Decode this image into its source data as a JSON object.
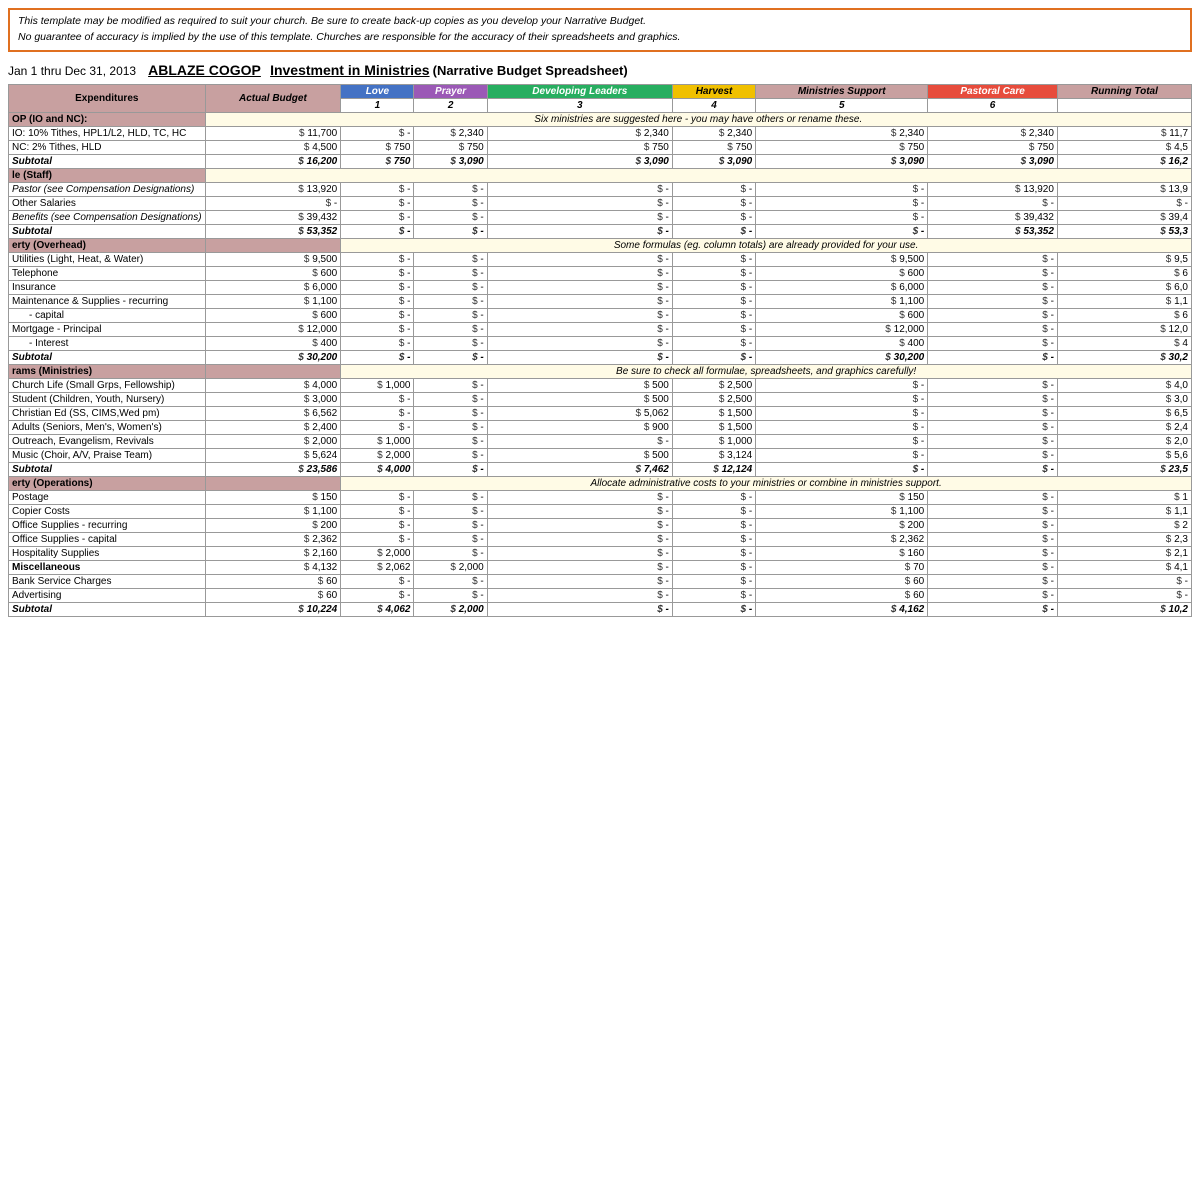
{
  "disclaimer": {
    "line1": "This template may be modified as required to suit your church.  Be sure to create back-up copies as you develop your Narrative Budget.",
    "line2": "No guarantee of accuracy is implied by the use of this template.  Churches are responsible for the accuracy of their spreadsheets and graphics."
  },
  "header": {
    "date_range": "Jan 1 thru Dec 31, 2013",
    "org_name": "ABLAZE COGOP",
    "title_part1": "Investment in Ministries",
    "title_part2": "(Narrative Budget Spreadsheet)"
  },
  "columns": {
    "expenditures": "Expenditures",
    "actual_budget": "Actual Budget",
    "love": "Love",
    "love_num": "1",
    "prayer": "Prayer",
    "prayer_num": "2",
    "developing": "Developing Leaders",
    "developing_num": "3",
    "harvest": "Harvest",
    "harvest_num": "4",
    "ministries_support": "Ministries Support",
    "ministries_num": "5",
    "pastoral_care": "Pastoral Care",
    "pastoral_num": "6",
    "running_total": "Running Total"
  },
  "notes": {
    "op_note": "Six ministries are suggested here - you may have others or rename these.",
    "property_note": "Some formulas (eg. column totals) are already provided for your use.",
    "programs_note": "Be sure to check all formulae, spreadsheets, and graphics carefully!",
    "admin_note": "Allocate administrative costs to your ministries or combine in ministries support."
  },
  "sections": [
    {
      "name": "OP (IO and NC):",
      "rows": [
        {
          "label": "IO: 10% Tithes, HPL1/L2, HLD, TC, HC",
          "actual": "11,700",
          "love": "-",
          "prayer": "2,340",
          "developing": "2,340",
          "harvest": "2,340",
          "ministries": "2,340",
          "pastoral": "2,340",
          "running": "11,7"
        },
        {
          "label": "NC: 2% Tithes, HLD",
          "actual": "4,500",
          "love": "750",
          "prayer": "750",
          "developing": "750",
          "harvest": "750",
          "ministries": "750",
          "pastoral": "750",
          "running": "4,5"
        },
        {
          "label": "Subtotal",
          "actual": "16,200",
          "love": "750",
          "prayer": "3,090",
          "developing": "3,090",
          "harvest": "3,090",
          "ministries": "3,090",
          "pastoral": "3,090",
          "running": "16,2",
          "is_subtotal": true
        }
      ]
    },
    {
      "name": "le (Staff)",
      "rows": [
        {
          "label": "Pastor (see Compensation Designations)",
          "actual": "13,920",
          "love": "-",
          "prayer": "-",
          "developing": "-",
          "harvest": "-",
          "ministries": "-",
          "pastoral": "13,920",
          "running": "13,9",
          "label_style": "italic"
        },
        {
          "label": "Other Salaries",
          "actual": "-",
          "love": "-",
          "prayer": "-",
          "developing": "-",
          "harvest": "-",
          "ministries": "-",
          "pastoral": "-",
          "running": "-"
        },
        {
          "label": "Benefits (see Compensation Designations)",
          "actual": "39,432",
          "love": "-",
          "prayer": "-",
          "developing": "-",
          "harvest": "-",
          "ministries": "-",
          "pastoral": "39,432",
          "running": "39,4",
          "label_style": "italic"
        },
        {
          "label": "Subtotal",
          "actual": "53,352",
          "love": "-",
          "prayer": "-",
          "developing": "-",
          "harvest": "-",
          "ministries": "-",
          "pastoral": "53,352",
          "running": "53,3",
          "is_subtotal": true
        }
      ]
    },
    {
      "name": "erty (Overhead)",
      "note": "Some formulas (eg. column totals) are already provided for your use.",
      "rows": [
        {
          "label": "Utilities (Light, Heat, & Water)",
          "actual": "9,500",
          "love": "-",
          "prayer": "-",
          "developing": "-",
          "harvest": "-",
          "ministries": "9,500",
          "pastoral": "-",
          "running": "9,5"
        },
        {
          "label": "Telephone",
          "actual": "600",
          "love": "-",
          "prayer": "-",
          "developing": "-",
          "harvest": "-",
          "ministries": "600",
          "pastoral": "-",
          "running": "6"
        },
        {
          "label": "Insurance",
          "actual": "6,000",
          "love": "-",
          "prayer": "-",
          "developing": "-",
          "harvest": "-",
          "ministries": "6,000",
          "pastoral": "-",
          "running": "6,0"
        },
        {
          "label": "Maintenance & Supplies - recurring",
          "actual": "1,100",
          "love": "-",
          "prayer": "-",
          "developing": "-",
          "harvest": "-",
          "ministries": "1,100",
          "pastoral": "-",
          "running": "1,1"
        },
        {
          "label": "- capital",
          "actual": "600",
          "love": "-",
          "prayer": "-",
          "developing": "-",
          "harvest": "-",
          "ministries": "600",
          "pastoral": "-",
          "running": "6",
          "label_indent": true
        },
        {
          "label": "Mortgage  - Principal",
          "actual": "12,000",
          "love": "-",
          "prayer": "-",
          "developing": "-",
          "harvest": "-",
          "ministries": "12,000",
          "pastoral": "-",
          "running": "12,0"
        },
        {
          "label": "- Interest",
          "actual": "400",
          "love": "-",
          "prayer": "-",
          "developing": "-",
          "harvest": "-",
          "ministries": "400",
          "pastoral": "-",
          "running": "4",
          "label_indent": true
        },
        {
          "label": "Subtotal",
          "actual": "30,200",
          "love": "-",
          "prayer": "-",
          "developing": "-",
          "harvest": "-",
          "ministries": "30,200",
          "pastoral": "-",
          "running": "30,2",
          "is_subtotal": true
        }
      ]
    },
    {
      "name": "rams (Ministries)",
      "note": "Be sure to check all formulae, spreadsheets, and graphics carefully!",
      "rows": [
        {
          "label": "Church Life (Small Grps, Fellowship)",
          "actual": "4,000",
          "love": "1,000",
          "prayer": "-",
          "developing": "500",
          "harvest": "2,500",
          "ministries": "-",
          "pastoral": "-",
          "running": "4,0"
        },
        {
          "label": "Student (Children, Youth, Nursery)",
          "actual": "3,000",
          "love": "-",
          "prayer": "-",
          "developing": "500",
          "harvest": "2,500",
          "ministries": "-",
          "pastoral": "-",
          "running": "3,0"
        },
        {
          "label": "Christian Ed (SS, CIMS,Wed pm)",
          "actual": "6,562",
          "love": "-",
          "prayer": "-",
          "developing": "5,062",
          "harvest": "1,500",
          "ministries": "-",
          "pastoral": "-",
          "running": "6,5"
        },
        {
          "label": "Adults (Seniors, Men's, Women's)",
          "actual": "2,400",
          "love": "-",
          "prayer": "-",
          "developing": "900",
          "harvest": "1,500",
          "ministries": "-",
          "pastoral": "-",
          "running": "2,4"
        },
        {
          "label": "Outreach, Evangelism, Revivals",
          "actual": "2,000",
          "love": "1,000",
          "prayer": "-",
          "developing": "-",
          "harvest": "1,000",
          "ministries": "-",
          "pastoral": "-",
          "running": "2,0"
        },
        {
          "label": "Music (Choir, A/V, Praise Team)",
          "actual": "5,624",
          "love": "2,000",
          "prayer": "-",
          "developing": "500",
          "harvest": "3,124",
          "ministries": "-",
          "pastoral": "-",
          "running": "5,6"
        },
        {
          "label": "Subtotal",
          "actual": "23,586",
          "love": "4,000",
          "prayer": "-",
          "developing": "7,462",
          "harvest": "12,124",
          "ministries": "-",
          "pastoral": "-",
          "running": "23,5",
          "is_subtotal": true
        }
      ]
    },
    {
      "name": "erty (Operations)",
      "note": "Allocate administrative costs to your ministries or combine in ministries support.",
      "rows": [
        {
          "label": "Postage",
          "actual": "150",
          "love": "-",
          "prayer": "-",
          "developing": "-",
          "harvest": "-",
          "ministries": "150",
          "pastoral": "-",
          "running": "1"
        },
        {
          "label": "Copier Costs",
          "actual": "1,100",
          "love": "-",
          "prayer": "-",
          "developing": "-",
          "harvest": "-",
          "ministries": "1,100",
          "pastoral": "-",
          "running": "1,1"
        },
        {
          "label": "Office Supplies - recurring",
          "actual": "200",
          "love": "-",
          "prayer": "-",
          "developing": "-",
          "harvest": "-",
          "ministries": "200",
          "pastoral": "-",
          "running": "2"
        },
        {
          "label": "Office Supplies - capital",
          "actual": "2,362",
          "love": "-",
          "prayer": "-",
          "developing": "-",
          "harvest": "-",
          "ministries": "2,362",
          "pastoral": "-",
          "running": "2,3"
        },
        {
          "label": "Hospitality Supplies",
          "actual": "2,160",
          "love": "2,000",
          "prayer": "-",
          "developing": "-",
          "harvest": "-",
          "ministries": "160",
          "pastoral": "-",
          "running": "2,1"
        },
        {
          "label": "Miscellaneous",
          "actual": "4,132",
          "love": "2,062",
          "prayer": "2,000",
          "developing": "-",
          "harvest": "-",
          "ministries": "70",
          "pastoral": "-",
          "running": "4,1",
          "label_style": "bold"
        },
        {
          "label": "Bank Service Charges",
          "actual": "60",
          "love": "-",
          "prayer": "-",
          "developing": "-",
          "harvest": "-",
          "ministries": "60",
          "pastoral": "-",
          "running": "-"
        },
        {
          "label": "Advertising",
          "actual": "60",
          "love": "-",
          "prayer": "-",
          "developing": "-",
          "harvest": "-",
          "ministries": "60",
          "pastoral": "-",
          "running": "-"
        },
        {
          "label": "Subtotal",
          "actual": "10,224",
          "love": "4,062",
          "prayer": "2,000",
          "developing": "-",
          "harvest": "-",
          "ministries": "4,162",
          "pastoral": "-",
          "running": "10,2",
          "is_subtotal": true
        }
      ]
    }
  ]
}
